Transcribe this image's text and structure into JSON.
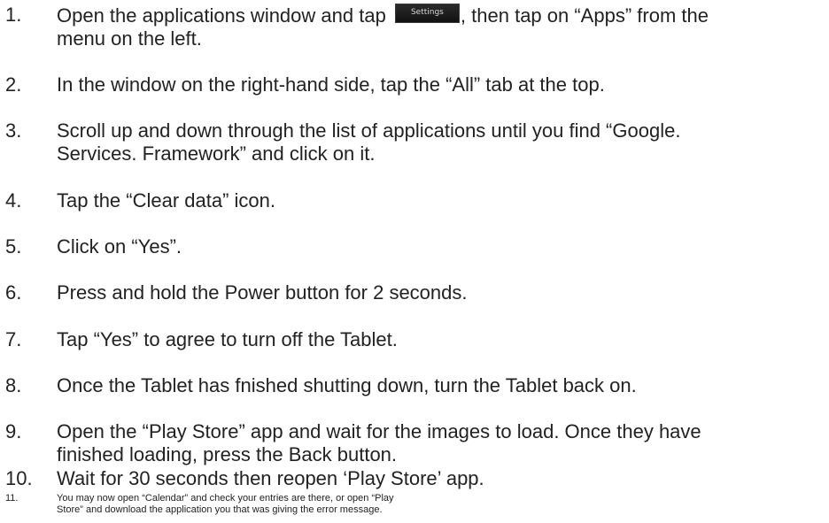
{
  "steps": [
    {
      "number": "1.",
      "before_icon": "Open the applications window and tap ",
      "icon_label": "Settings",
      "after_icon": ", then tap on “Apps” from the",
      "line2": "menu on the left."
    },
    {
      "number": "2.",
      "text": "In the window on the right-hand side, tap the “All” tab at the top."
    },
    {
      "number": "3.",
      "line1": "Scroll up and down through the list of applications until you find “Google.",
      "line2": "Services. Framework” and click on it."
    },
    {
      "number": "4.",
      "text": "Tap the “Clear data” icon."
    },
    {
      "number": "5.",
      "text": "Click on “Yes”."
    },
    {
      "number": "6.",
      "text": "Press and hold the Power button for 2 seconds."
    },
    {
      "number": "7.",
      "text": "Tap “Yes” to agree to turn off the Tablet."
    },
    {
      "number": "8.",
      "text": "Once the Tablet has fnished shutting down, turn the Tablet back on."
    },
    {
      "number": "9.",
      "line1": "Open the “Play Store” app and wait for the images to load. Once they have",
      "line2": "finished loading, press the Back button."
    },
    {
      "number": "10.",
      "text": "Wait for 30 seconds then reopen ‘Play Store’ app."
    },
    {
      "number": "11.",
      "line1": "You may now open “Calendar” and check your entries are there, or open “Play",
      "line2": "Store” and download the application you that was giving the error message."
    }
  ]
}
